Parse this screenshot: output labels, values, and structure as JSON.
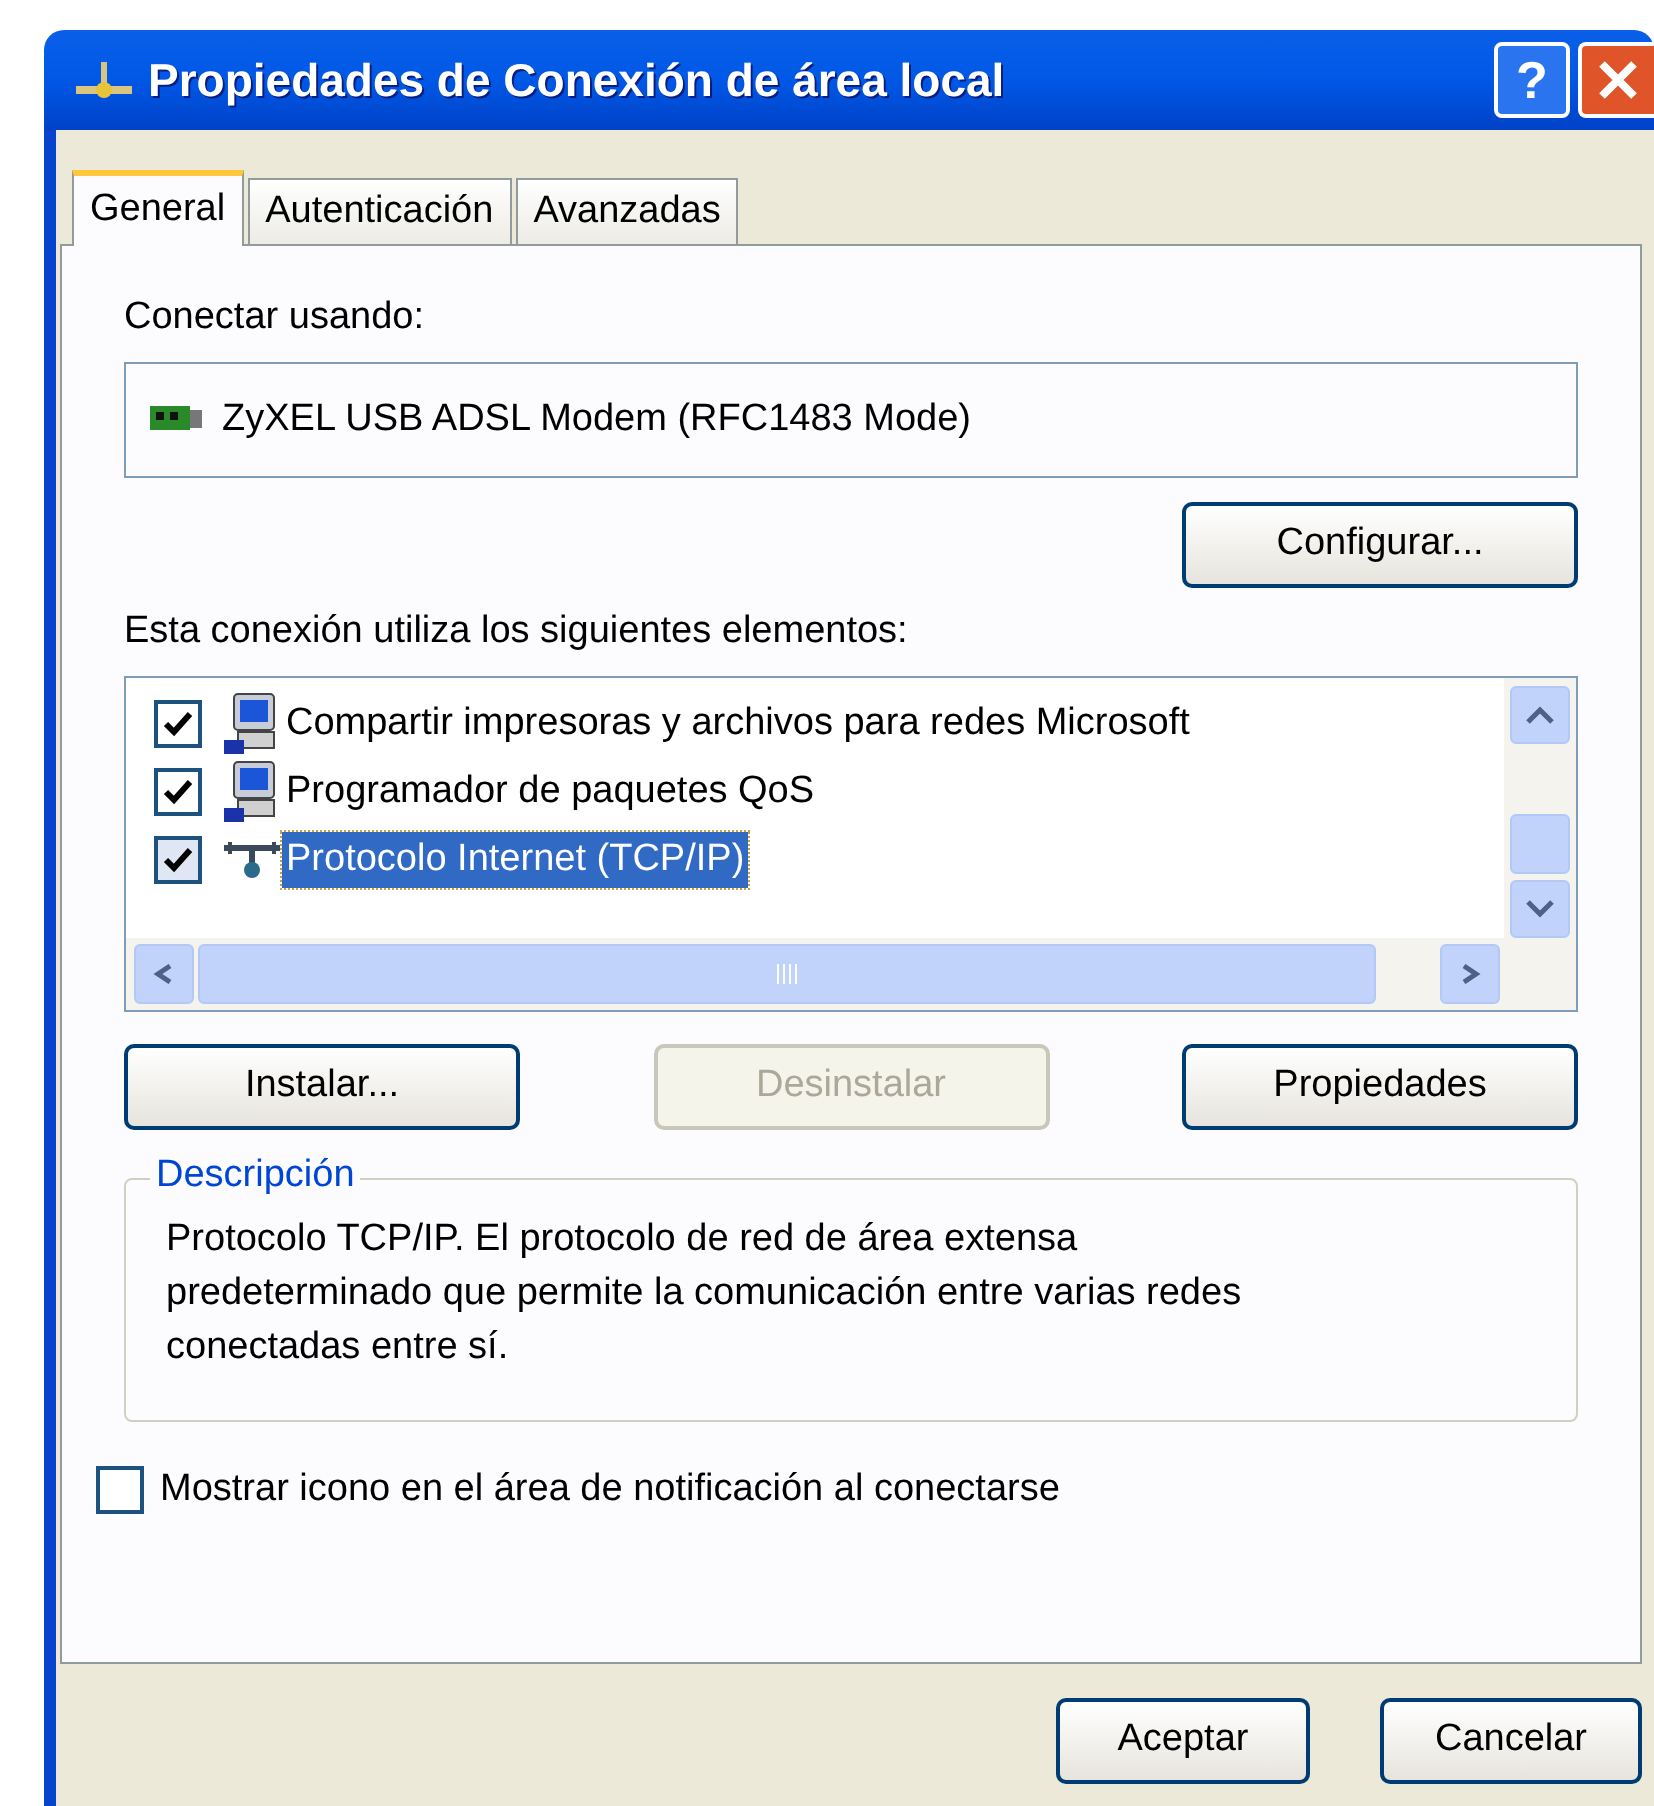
{
  "window": {
    "title": "Propiedades de Conexión de área local",
    "help_label": "?"
  },
  "tabs": [
    {
      "label": "General",
      "selected": true
    },
    {
      "label": "Autenticación",
      "selected": false
    },
    {
      "label": "Avanzadas",
      "selected": false
    }
  ],
  "connect_using": {
    "label": "Conectar usando:",
    "adapter": "ZyXEL USB ADSL Modem (RFC1483 Mode)",
    "button": "Configurar..."
  },
  "components": {
    "label": "Esta conexión utiliza los siguientes elementos:",
    "items": [
      {
        "kind": "service",
        "label": "Compartir impresoras y archivos para redes Microsoft",
        "checked": true,
        "selected": false
      },
      {
        "kind": "service",
        "label": "Programador de paquetes QoS",
        "checked": true,
        "selected": false
      },
      {
        "kind": "protocol",
        "label": "Protocolo Internet (TCP/IP)",
        "checked": true,
        "selected": true
      }
    ]
  },
  "actions": [
    {
      "label": "Instalar...",
      "disabled": false
    },
    {
      "label": "Desinstalar",
      "disabled": true
    },
    {
      "label": "Propiedades",
      "disabled": false
    }
  ],
  "description": {
    "legend": "Descripción",
    "text": "Protocolo TCP/IP. El protocolo de red de área extensa predeterminado que permite la comunicación entre varias redes conectadas entre sí."
  },
  "notify": {
    "label": "Mostrar icono en el área de notificación al conectarse",
    "checked": false
  },
  "buttons": [
    {
      "label": "Aceptar"
    },
    {
      "label": "Cancelar"
    }
  ]
}
